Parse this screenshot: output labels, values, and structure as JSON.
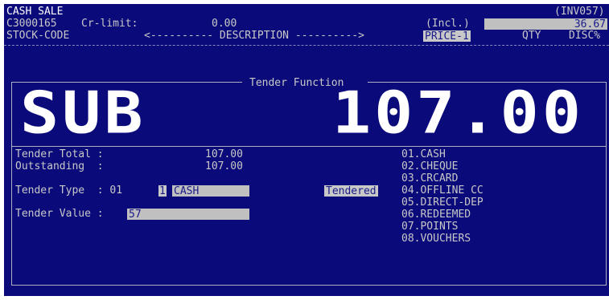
{
  "header": {
    "title": "CASH SALE",
    "invoice_no": "(INV057)",
    "customer_code": "C3000165",
    "credit_label": "Cr-limit:",
    "credit_value": "0.00",
    "incl_label": "(Incl.)",
    "incl_value": "36.67"
  },
  "columns": {
    "stock_code": "STOCK-CODE",
    "description": "<---------- DESCRIPTION ---------->",
    "price": "PRICE-1",
    "qty": "QTY",
    "disc": "DISC%"
  },
  "tender": {
    "panel_title": "Tender Function",
    "big_label": "SUB",
    "big_amount": "107.00",
    "total_label": "Tender Total :",
    "total_value": "107.00",
    "outstanding_label": "Outstanding  :",
    "outstanding_value": "107.00",
    "type_label": "Tender Type  : 01",
    "type_code": "1",
    "type_value": "CASH",
    "tendered_label": "Tendered",
    "value_label": "Tender Value :",
    "value_input": "57"
  },
  "tender_options": [
    "01.CASH",
    "02.CHEQUE",
    "03.CRCARD",
    "04.OFFLINE CC",
    "05.DIRECT-DEP",
    "06.REDEEMED",
    "07.POINTS",
    "08.VOUCHERS"
  ],
  "colors": {
    "screen_bg": "#0a0a7a",
    "text": "#c8c8c8",
    "field_bg": "#c0c0c0",
    "field_text": "#1a1a8a"
  }
}
